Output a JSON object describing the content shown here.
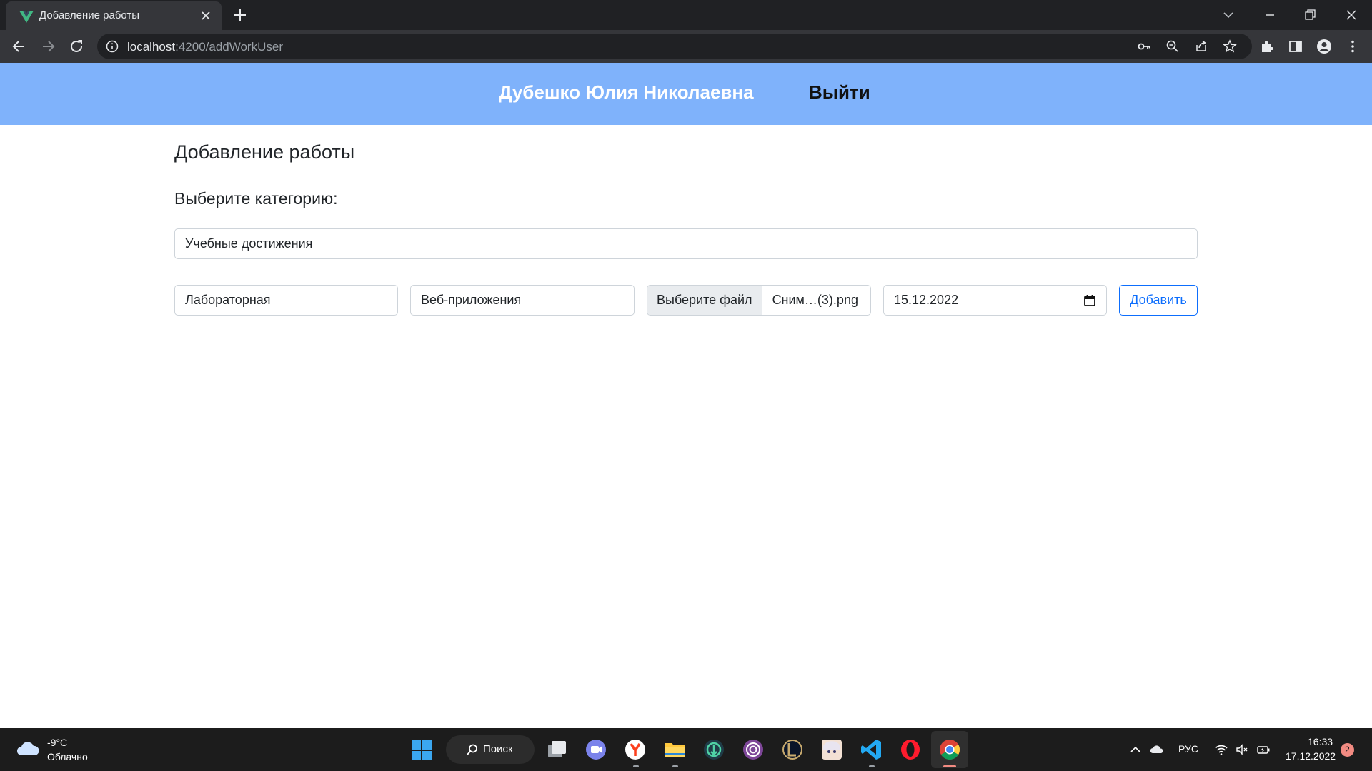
{
  "browser": {
    "tab_title": "Добавление работы",
    "url_host": "localhost",
    "url_path": ":4200/addWorkUser"
  },
  "header": {
    "user_name": "Дубешко Юлия Николаевна",
    "logout_label": "Выйти",
    "background_color": "#7fb2fb"
  },
  "page": {
    "title": "Добавление работы",
    "category_label": "Выберите категорию:",
    "category_value": "Учебные достижения"
  },
  "form": {
    "work_type": "Лабораторная",
    "subject": "Веб-приложения",
    "file_button_label": "Выберите файл",
    "file_name": "Сним…(3).png",
    "date": "15.12.2022",
    "add_button_label": "Добавить",
    "accent_color": "#0d6efd"
  },
  "taskbar": {
    "weather_temp": "-9°C",
    "weather_condition": "Облачно",
    "search_label": "Поиск",
    "language": "РУС",
    "time": "16:33",
    "date": "17.12.2022",
    "notification_count": "2",
    "apps": [
      "task-view-icon",
      "teams-icon",
      "yandex-browser-icon",
      "file-explorer-icon",
      "game-launcher-icon",
      "tor-browser-icon",
      "league-of-legends-icon",
      "anime-app-icon",
      "vscode-icon",
      "opera-icon",
      "chrome-icon"
    ]
  }
}
